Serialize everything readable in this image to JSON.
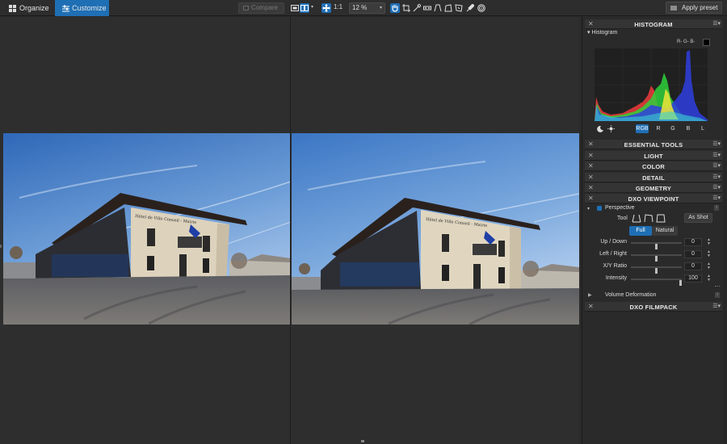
{
  "toolbar": {
    "tabs": [
      {
        "label": "Organize",
        "icon": "grid-icon",
        "active": false
      },
      {
        "label": "Customize",
        "icon": "sliders-icon",
        "active": true
      }
    ],
    "compare_label": "Compare",
    "zoom_fit_label": "1:1",
    "zoom_value": "12 %",
    "apply_preset_label": "Apply preset",
    "accent_color": "#1f6fb5",
    "tool_icons": [
      "single-view-icon",
      "split-view-icon",
      "move-icon",
      "hand-icon",
      "crop-icon",
      "eyedropper-icon",
      "red-eye-icon",
      "horizon-icon",
      "perspective-icon",
      "volume-icon",
      "repair-icon",
      "local-adjust-icon"
    ]
  },
  "histogram": {
    "title": "HISTOGRAM",
    "subtitle": "Histogram",
    "readout": "R- G- B-",
    "channels": [
      "RGB",
      "R",
      "G",
      "B",
      "L"
    ],
    "active_channel": "RGB"
  },
  "panels": {
    "essential_tools": "ESSENTIAL TOOLS",
    "light": "LIGHT",
    "color": "COLOR",
    "detail": "DETAIL",
    "geometry": "GEOMETRY",
    "dxo_viewpoint": "DXO VIEWPOINT",
    "dxo_filmpack": "DXO FILMPACK"
  },
  "viewpoint": {
    "perspective_label": "Perspective",
    "tool_label": "Tool",
    "as_shot_label": "As Shot",
    "mode_full": "Full",
    "mode_natural": "Natural",
    "sliders": [
      {
        "label": "Up / Down",
        "value": "0",
        "fraction": 0.5
      },
      {
        "label": "Left / Right",
        "value": "0",
        "fraction": 0.5
      },
      {
        "label": "X/Y Ratio",
        "value": "0",
        "fraction": 0.5
      },
      {
        "label": "Intensity",
        "value": "100",
        "fraction": 1.0
      }
    ],
    "volume_deformation_label": "Volume Deformation"
  },
  "viewer": {
    "before_sign": "Hôtel de Ville  Conseil - Mairie",
    "after_sign": "Hôtel de Ville  Conseil - Mairie"
  }
}
